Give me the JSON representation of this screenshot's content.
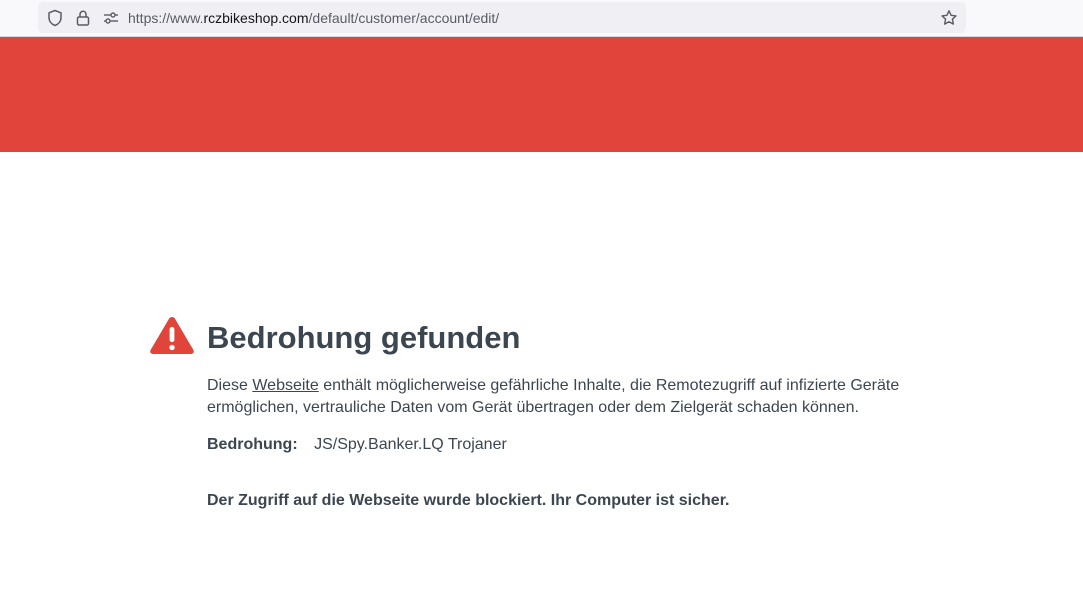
{
  "browser": {
    "url_prefix": "https://www.",
    "url_host": "rczbikeshop.com",
    "url_path": "/default/customer/account/edit/",
    "icons": [
      "shield-icon",
      "lock-icon",
      "permissions-icon",
      "bookmark-star-icon"
    ]
  },
  "colors": {
    "banner": "#e0443a",
    "warning": "#e0443a",
    "text": "#3c4650"
  },
  "alert": {
    "title": "Bedrohung gefunden",
    "desc_before": "Diese ",
    "desc_link": "Webseite",
    "desc_after": " enthält möglicherweise gefährliche Inhalte, die Remotezugriff auf infizierte Geräte ermöglichen, vertrauliche Daten vom Gerät übertragen oder dem Zielgerät schaden können.",
    "threat_label": "Bedrohung:",
    "threat_value": "JS/Spy.Banker.LQ Trojaner",
    "blocked_message": "Der Zugriff auf die Webseite wurde blockiert. Ihr Computer ist sicher."
  }
}
